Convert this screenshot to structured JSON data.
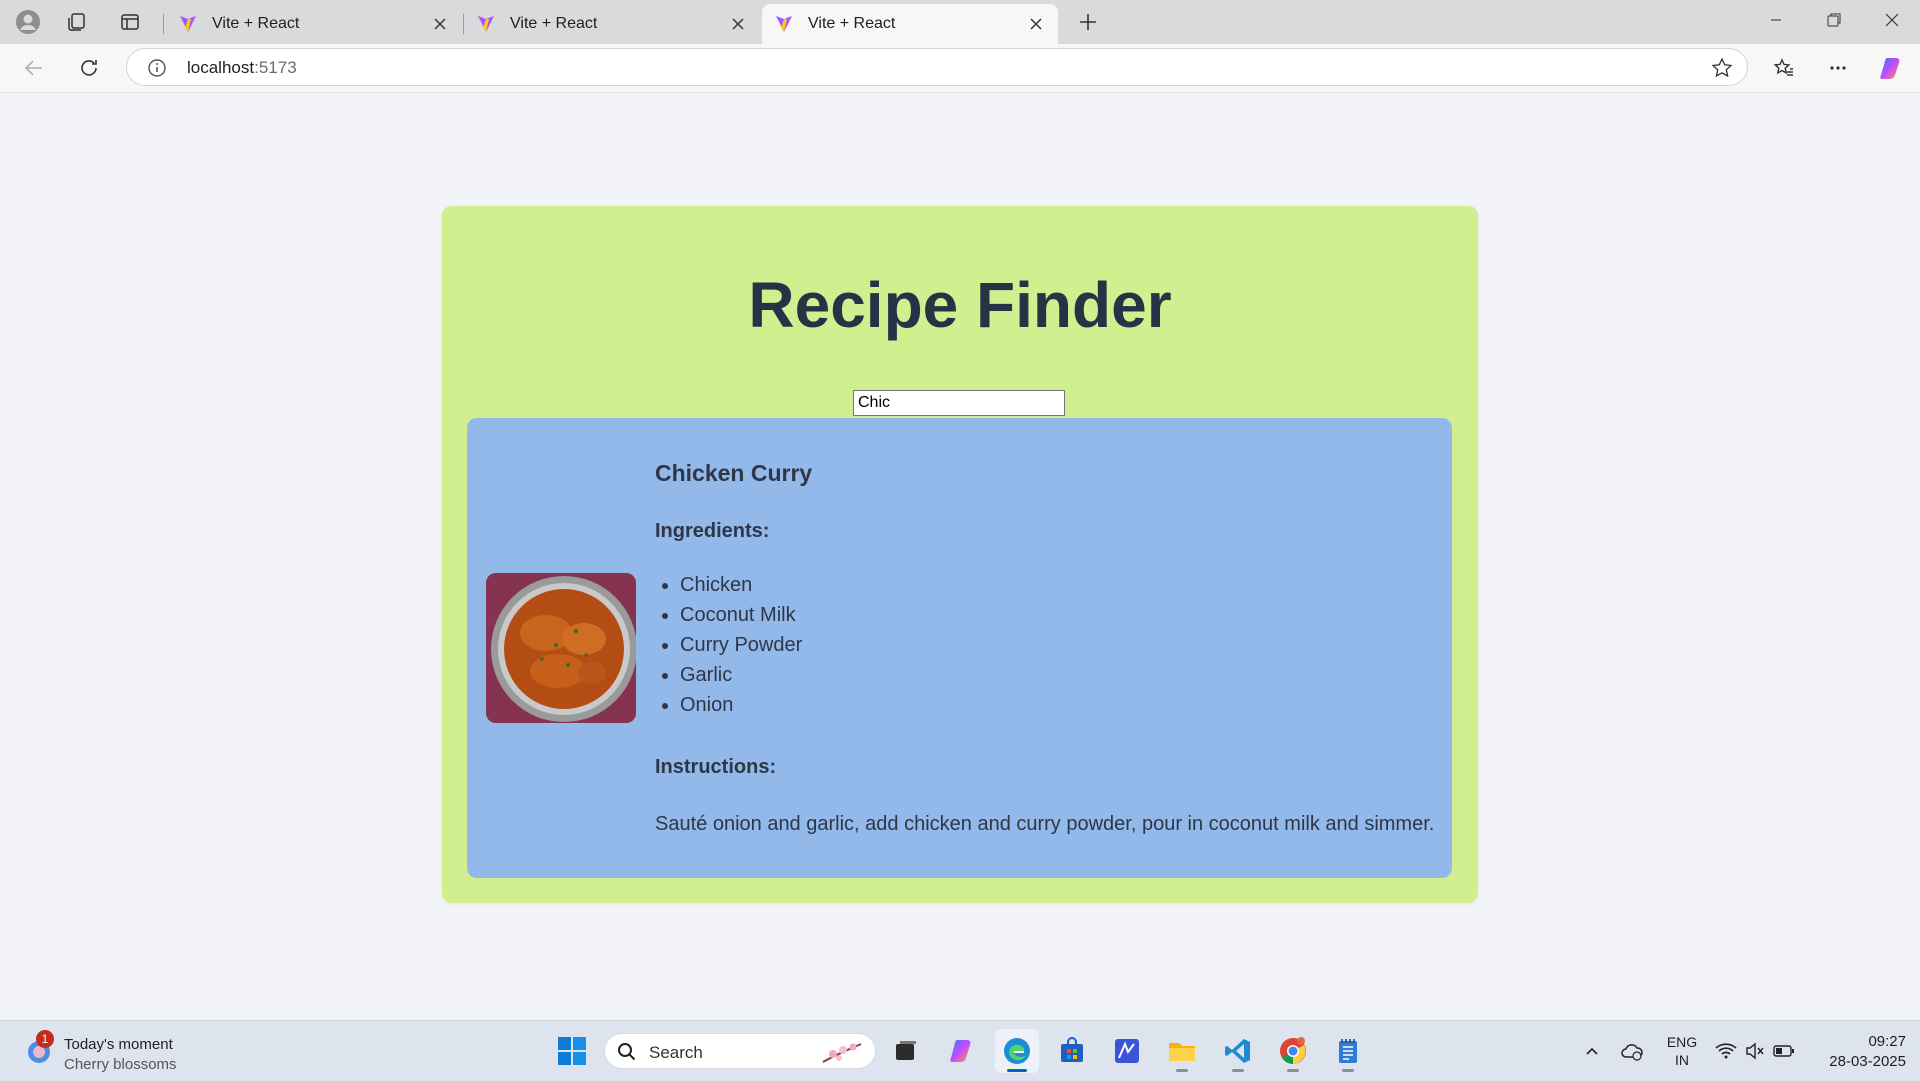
{
  "browser": {
    "tabs": [
      {
        "title": "Vite + React",
        "active": false
      },
      {
        "title": "Vite + React",
        "active": false
      },
      {
        "title": "Vite + React",
        "active": true
      }
    ],
    "address": {
      "host": "localhost",
      "port": ":5173"
    }
  },
  "app": {
    "title": "Recipe Finder",
    "search": {
      "value": "Chic"
    },
    "recipe": {
      "name": "Chicken Curry",
      "ingredients_label": "Ingredients:",
      "ingredients": [
        "Chicken",
        "Coconut Milk",
        "Curry Powder",
        "Garlic",
        "Onion"
      ],
      "instructions_label": "Instructions:",
      "instructions": "Sauté onion and garlic, add chicken and curry powder, pour in coconut milk and simmer."
    },
    "colors": {
      "app_bg": "#d2ef8f",
      "card_bg": "#93b8ea",
      "title_text": "#243447"
    }
  },
  "taskbar": {
    "widget": {
      "badge": "1",
      "line1": "Today's moment",
      "line2": "Cherry blossoms"
    },
    "search_label": "Search",
    "tray": {
      "lang1": "ENG",
      "lang2": "IN",
      "time": "09:27",
      "date": "28-03-2025"
    }
  }
}
